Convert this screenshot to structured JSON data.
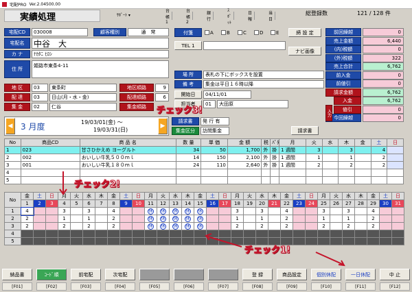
{
  "app": {
    "title": "宅配PRO",
    "version": "Ver.2.04500.00"
  },
  "header": {
    "page_title": "実績処理",
    "menu": "ｻﾎﾟｰﾄ ▾",
    "tabs": [
      "台帳1",
      "台帳2",
      "銀行",
      "ｽﾎﾟｯﾄ",
      "日報",
      "当日"
    ],
    "total_label": "総登録数",
    "total_value": "121 / 128 件"
  },
  "customer": {
    "code_label": "宅配CD",
    "code": "030008",
    "type_label": "顧客種別",
    "type": "通　常",
    "name_label": "宅配名",
    "name": "中谷　大",
    "kana_label": "カ ナ",
    "kana": "ﾅｶﾀﾆ ﾋﾛｼ",
    "addr_label": "住 所",
    "addr": "姫路市東条4-11",
    "district_label": "地 区",
    "district_no": "03",
    "district": "東条町",
    "district_order_label": "地区順路",
    "district_order": "9",
    "delivery_label": "配 達",
    "delivery_no": "03",
    "delivery": "日山(月・水・金)",
    "delivery_order_label": "配達順路",
    "delivery_order": "6",
    "collect_label": "集 金",
    "collect_no": "02",
    "collect": "仁谷",
    "collect_order_label": "集金順路"
  },
  "attach": {
    "label": "付箋",
    "options": [
      "A",
      "B",
      "C",
      "D",
      "E"
    ],
    "setting_button": "締 設 定"
  },
  "tel": {
    "label": "TEL 1",
    "value": ""
  },
  "navi_button": "ナビ画像",
  "place": {
    "label": "場 所",
    "value": "表札の下にボックスを設置"
  },
  "note": {
    "label": "備 考",
    "value": "集金は平日１６時以降"
  },
  "start": {
    "label": "開始日",
    "value": "04/11/01"
  },
  "staff": {
    "label": "担当者",
    "no": "01",
    "name": "大田原"
  },
  "invoice": {
    "label": "請求書",
    "value": "発 行 有",
    "collect_label": "集金区分",
    "collect_value": "訪問集金",
    "button": "請求書"
  },
  "month": {
    "label": "3 月度",
    "from": "19/03/01(金) 〜",
    "to": "19/03/31(日)"
  },
  "balances": [
    {
      "label": "前回繰越",
      "value": "0"
    },
    {
      "label": "売上金額",
      "value": "6,440"
    },
    {
      "label": "(内)税額",
      "value": "0"
    },
    {
      "label": "(外)税額",
      "value": "322"
    },
    {
      "label": "売上合計",
      "value": "6,762"
    },
    {
      "label": "前入金",
      "value": "0"
    },
    {
      "label": "前値引",
      "value": "0"
    },
    {
      "label": "請求金額",
      "value": "6,762"
    },
    {
      "label": "入金",
      "value": "6,762"
    },
    {
      "label": "値引",
      "value": "0"
    },
    {
      "label": "今回繰越",
      "value": "0"
    }
  ],
  "nyuka_label": "入力",
  "products": {
    "headers": [
      "No",
      "商品CD",
      "商 品 名",
      "数 量",
      "単 価",
      "金 額",
      "税",
      "ﾊﾟﾀｰﾝ",
      "月",
      "火",
      "水",
      "木",
      "金",
      "土",
      "日"
    ],
    "rows": [
      {
        "no": "1",
        "cd": "023",
        "name": "甘さひかえめ ヨーグルト",
        "qty": "34",
        "price": "50",
        "amount": "1,700",
        "tax": "外",
        "pay": "掛",
        "pattern": "1 週間",
        "mon": "3",
        "tue": "",
        "wed": "3",
        "thu": "",
        "fri": "4",
        "sat": "",
        "sun": ""
      },
      {
        "no": "2",
        "cd": "002",
        "name": "おいしい牛乳５００ｍｌ",
        "qty": "14",
        "price": "150",
        "amount": "2,100",
        "tax": "外",
        "pay": "掛",
        "pattern": "1 週間",
        "mon": "1",
        "tue": "",
        "wed": "1",
        "thu": "",
        "fri": "2",
        "sat": "",
        "sun": ""
      },
      {
        "no": "3",
        "cd": "001",
        "name": "おいしい牛乳１８０ｍｌ",
        "qty": "24",
        "price": "110",
        "amount": "2,640",
        "tax": "外",
        "pay": "掛",
        "pattern": "1 週間",
        "mon": "2",
        "tue": "",
        "wed": "2",
        "thu": "",
        "fri": "2",
        "sat": "",
        "sun": ""
      },
      {
        "no": "4",
        "cd": "",
        "name": "",
        "qty": "",
        "price": "",
        "amount": "",
        "tax": "",
        "pay": "",
        "pattern": "",
        "mon": "",
        "tue": "",
        "wed": "",
        "thu": "",
        "fri": "",
        "sat": "",
        "sun": ""
      },
      {
        "no": "5",
        "cd": "",
        "name": "",
        "qty": "",
        "price": "",
        "amount": "",
        "tax": "",
        "pay": "",
        "pattern": "",
        "mon": "",
        "tue": "",
        "wed": "",
        "thu": "",
        "fri": "",
        "sat": "",
        "sun": ""
      }
    ]
  },
  "calendar": {
    "no_label": "No",
    "days": [
      {
        "w": "金",
        "d": "1"
      },
      {
        "w": "土",
        "d": "2"
      },
      {
        "w": "日",
        "d": "3"
      },
      {
        "w": "月",
        "d": "4"
      },
      {
        "w": "火",
        "d": "5"
      },
      {
        "w": "水",
        "d": "6"
      },
      {
        "w": "木",
        "d": "7"
      },
      {
        "w": "金",
        "d": "8"
      },
      {
        "w": "土",
        "d": "9"
      },
      {
        "w": "日",
        "d": "10"
      },
      {
        "w": "月",
        "d": "11"
      },
      {
        "w": "火",
        "d": "12"
      },
      {
        "w": "水",
        "d": "13"
      },
      {
        "w": "木",
        "d": "14"
      },
      {
        "w": "金",
        "d": "15"
      },
      {
        "w": "土",
        "d": "16"
      },
      {
        "w": "日",
        "d": "17"
      },
      {
        "w": "月",
        "d": "18"
      },
      {
        "w": "火",
        "d": "19"
      },
      {
        "w": "水",
        "d": "20"
      },
      {
        "w": "木",
        "d": "21"
      },
      {
        "w": "金",
        "d": "22"
      },
      {
        "w": "土",
        "d": "23"
      },
      {
        "w": "日",
        "d": "24"
      },
      {
        "w": "月",
        "d": "25"
      },
      {
        "w": "火",
        "d": "26"
      },
      {
        "w": "水",
        "d": "27"
      },
      {
        "w": "木",
        "d": "28"
      },
      {
        "w": "金",
        "d": "29"
      },
      {
        "w": "土",
        "d": "30"
      },
      {
        "w": "日",
        "d": "31"
      }
    ],
    "rows": [
      {
        "no": "1",
        "cells": [
          "4",
          "",
          "",
          "3",
          "",
          "3",
          "",
          "4",
          "",
          "",
          "休",
          "休",
          "休",
          "休",
          "休",
          "",
          "",
          "3",
          "",
          "3",
          "",
          "4",
          "",
          "",
          "3",
          "",
          "3",
          "",
          "4",
          "",
          ""
        ]
      },
      {
        "no": "2",
        "cells": [
          "2",
          "",
          "",
          "1",
          "",
          "1",
          "",
          "2",
          "",
          "",
          "休",
          "休",
          "休",
          "休",
          "休",
          "",
          "",
          "1",
          "",
          "1",
          "",
          "2",
          "",
          "",
          "1",
          "",
          "1",
          "",
          "2",
          "",
          ""
        ]
      },
      {
        "no": "3",
        "cells": [
          "2",
          "",
          "",
          "2",
          "",
          "2",
          "",
          "2",
          "",
          "",
          "休",
          "休",
          "休",
          "休",
          "休",
          "",
          "",
          "2",
          "",
          "2",
          "",
          "2",
          "",
          "",
          "2",
          "",
          "2",
          "",
          "2",
          "",
          ""
        ]
      },
      {
        "no": "4",
        "cells": []
      },
      {
        "no": "5",
        "cells": []
      }
    ]
  },
  "annotations": {
    "check1": "チェック1!",
    "check2": "チェック2!",
    "check3": "チェック3!"
  },
  "footer": {
    "buttons": [
      "納品書",
      "ｺｰﾄﾞ順",
      "前宅配",
      "次宅配",
      "",
      "",
      "",
      "登 録",
      "商品設定",
      "個別休配",
      "一日休配",
      "中 止"
    ],
    "keys": [
      "[F01]",
      "[F02]",
      "[F03]",
      "[F04]",
      "[F05]",
      "[F06]",
      "[F07]",
      "[F08]",
      "[F09]",
      "[F10]",
      "[F11]",
      "[F12]"
    ]
  },
  "colors": {
    "blue_label": "#1f4aa8",
    "red_label": "#b0131b",
    "pink": "#f7cbd8",
    "green": "#b9f0d0",
    "holiday_blue": "#1a3fc4"
  }
}
